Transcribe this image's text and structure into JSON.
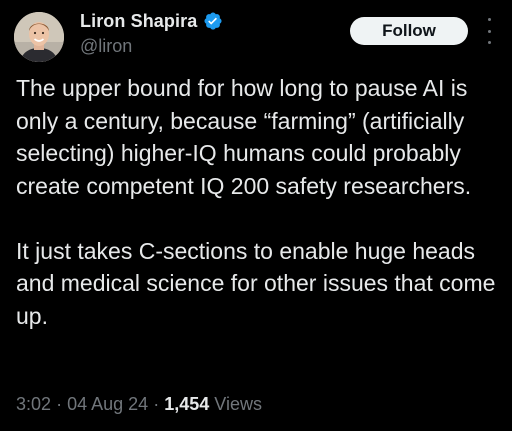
{
  "author": {
    "display_name": "Liron Shapira",
    "handle": "@liron",
    "verified_icon": "verified-badge-icon",
    "avatar_icon": "avatar-photo"
  },
  "actions": {
    "follow_label": "Follow",
    "more_icon": "more-vertical-icon"
  },
  "tweet": {
    "paragraphs": [
      "The upper bound for how long to pause AI is only a century, because “farming” (artificially selecting) higher-IQ humans could probably create competent IQ 200 safety researchers.",
      "It just takes C-sections to enable huge heads and medical science for other issues that come up."
    ]
  },
  "meta": {
    "time": "3:02",
    "separator": "·",
    "date": "04 Aug 24",
    "views_count": "1,454",
    "views_label": "Views"
  },
  "colors": {
    "background": "#000000",
    "text": "#e7e9ea",
    "muted": "#71767b",
    "verified": "#1d9bf0",
    "follow_bg": "#eff3f4"
  }
}
